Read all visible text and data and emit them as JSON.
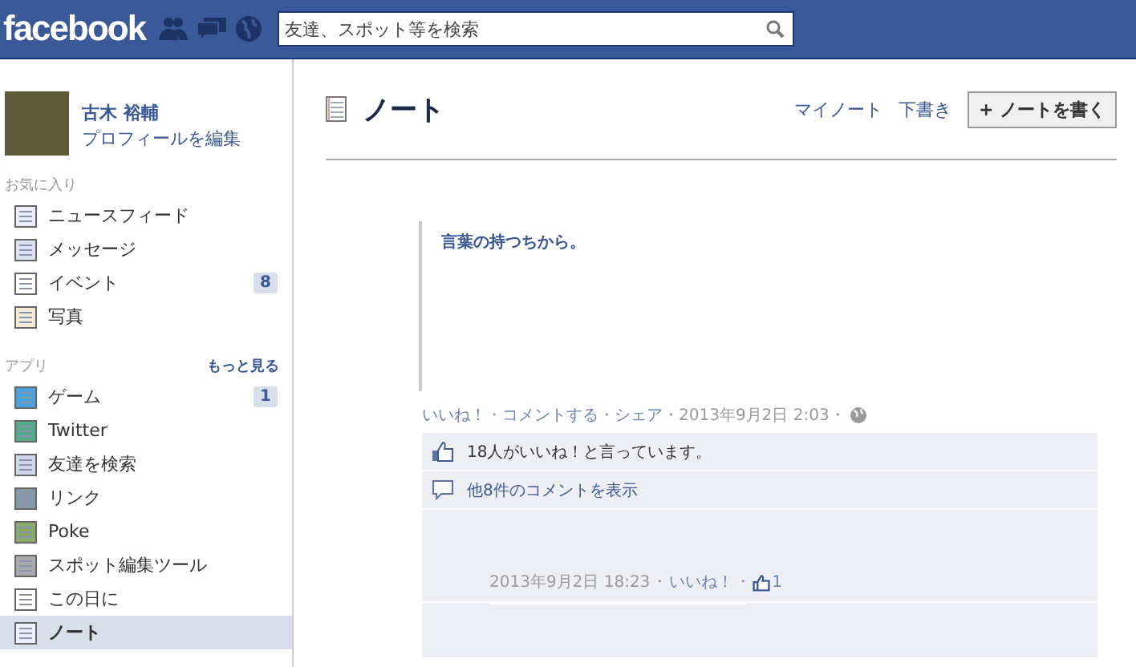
{
  "topbar": {
    "logo": "facebook",
    "search": {
      "placeholder": "友達、スポット等を検索"
    }
  },
  "sidebar": {
    "profile": {
      "name": "古木 裕輔",
      "edit_link": "プロフィールを編集"
    },
    "sections": [
      {
        "title": "お気に入り",
        "items": [
          {
            "label": "ニュースフィード",
            "selected": false
          },
          {
            "label": "メッセージ",
            "selected": false
          },
          {
            "label": "イベント",
            "badge": "8",
            "selected": false
          },
          {
            "label": "写真",
            "selected": false
          }
        ]
      },
      {
        "title": "アプリ",
        "more": "もっと見る",
        "items": [
          {
            "label": "ゲーム",
            "badge": "1",
            "selected": false
          },
          {
            "label": "Twitter",
            "selected": false
          },
          {
            "label": "友達を検索",
            "selected": false
          },
          {
            "label": "リンク",
            "selected": false
          },
          {
            "label": "Poke",
            "selected": false
          },
          {
            "label": "スポット編集ツール",
            "selected": false
          },
          {
            "label": "この日に",
            "selected": false
          },
          {
            "label": "ノート",
            "selected": true
          }
        ]
      }
    ]
  },
  "page": {
    "title": "ノート",
    "links": [
      "マイノート",
      "下書き"
    ],
    "write_button": "+ ノートを書く"
  },
  "note": {
    "quote": "言葉の持つちから。",
    "separator": "・",
    "actions": [
      {
        "kind": "link",
        "text": "いいね！"
      },
      {
        "kind": "link",
        "text": "コメントする"
      },
      {
        "kind": "link",
        "text": "シェア"
      },
      {
        "kind": "time",
        "text": "2013年9月2日 2:03"
      }
    ],
    "likes": "18人がいいね！と言っています。",
    "more_comments": "他8件のコメントを表示",
    "comment": {
      "time": "2013年9月2日 18:23",
      "like": "いいね！",
      "like_count": "1"
    }
  }
}
